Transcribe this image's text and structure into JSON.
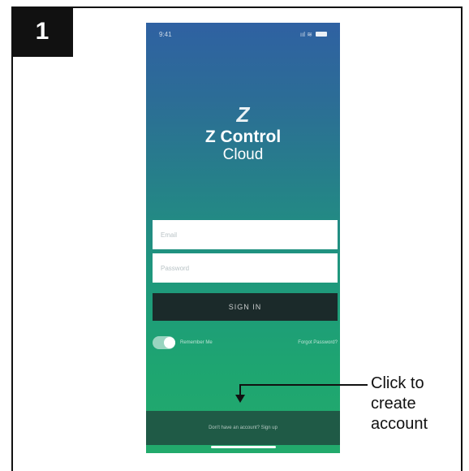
{
  "step": {
    "number": "1"
  },
  "phone": {
    "status": {
      "time": "9:41",
      "signal": "ııl ≋"
    },
    "logo_mark": "Z",
    "title": "Z Control",
    "subtitle": "Cloud",
    "email_placeholder": "Email",
    "password_placeholder": "Password",
    "sign_in_label": "SIGN IN",
    "remember_label": "Remember Me",
    "forgot_label": "Forgot Password?",
    "create_account_label": "Don't have an account? Sign up"
  },
  "callout": {
    "lines": [
      "Click to",
      "create",
      "account"
    ]
  },
  "colors": {
    "frame": "#111111",
    "phone_top": "#2f61a2",
    "phone_bottom": "#22aa6c",
    "button": "#1b2a2a",
    "create_bar": "#1f5a46"
  }
}
